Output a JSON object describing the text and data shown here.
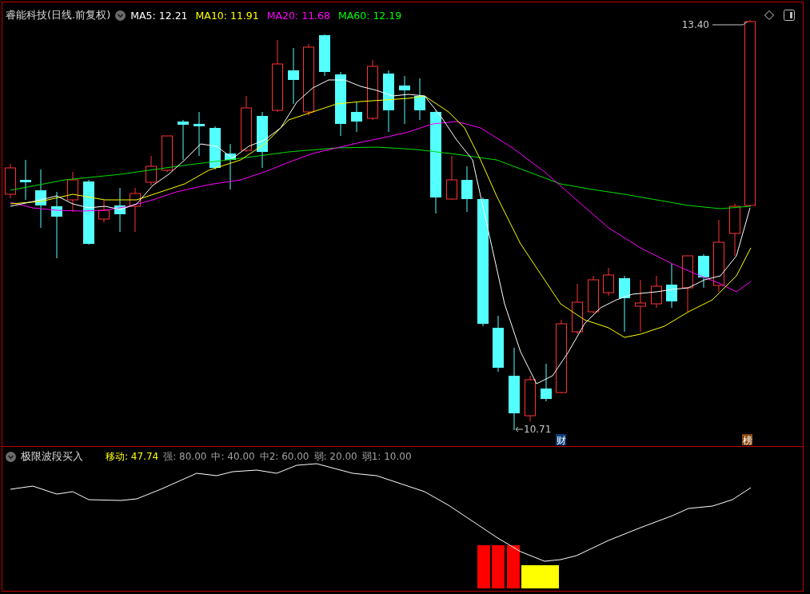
{
  "main_panel": {
    "title": "睿能科技(日线.前复权)",
    "indicators": [
      {
        "label": "MA5:",
        "value": "12.21",
        "color": "#ffffff"
      },
      {
        "label": "MA10:",
        "value": "11.91",
        "color": "#ffff00"
      },
      {
        "label": "MA20:",
        "value": "11.68",
        "color": "#ff00ff"
      },
      {
        "label": "MA60:",
        "value": "12.19",
        "color": "#00ff00"
      }
    ],
    "high_label": "13.40",
    "low_label": "10.71",
    "badges": [
      {
        "text": "财",
        "color": "#0a3d7a"
      },
      {
        "text": "榜",
        "color": "#8a4a10"
      }
    ]
  },
  "lower_panel": {
    "title": "极限波段买入",
    "readings": [
      {
        "label": "移动:",
        "value": "47.74",
        "color": "#ffff00"
      },
      {
        "label": "强:",
        "value": "80.00",
        "color": "#a0a0a0"
      },
      {
        "label": "中:",
        "value": "40.00",
        "color": "#a0a0a0"
      },
      {
        "label": "中2:",
        "value": "60.00",
        "color": "#a0a0a0"
      },
      {
        "label": "弱:",
        "value": "20.00",
        "color": "#a0a0a0"
      },
      {
        "label": "弱1:",
        "value": "10.00",
        "color": "#a0a0a0"
      }
    ]
  }
}
